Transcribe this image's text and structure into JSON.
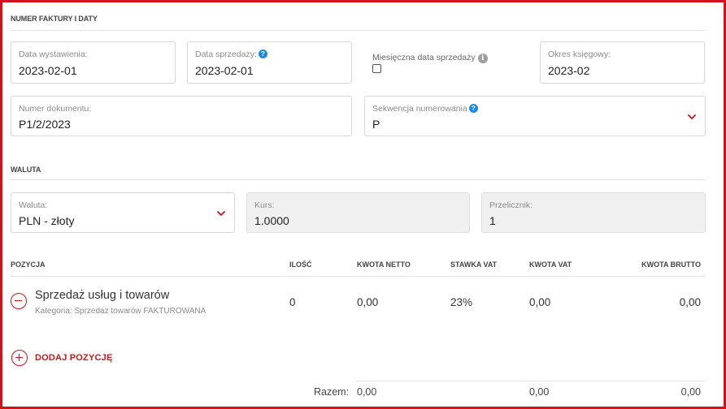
{
  "sections": {
    "invoice": "NUMER FAKTURY I DATY",
    "currency": "WALUTA"
  },
  "fields": {
    "issue_date": {
      "label": "Data wystawienia:",
      "value": "2023-02-01"
    },
    "sale_date": {
      "label": "Data sprzedaży:",
      "value": "2023-02-01"
    },
    "monthly_sale_date": {
      "label": "Miesięczna data sprzedaży",
      "checked": false
    },
    "accounting_period": {
      "label": "Okres księgowy:",
      "value": "2023-02"
    },
    "document_number": {
      "label": "Numer dokumentu:",
      "value": "P1/2/2023"
    },
    "numbering_sequence": {
      "label": "Sekwencja numerowania",
      "value": "P"
    },
    "currency": {
      "label": "Waluta:",
      "value": "PLN - złoty"
    },
    "rate": {
      "label": "Kurs:",
      "value": "1.0000"
    },
    "converter": {
      "label": "Przelicznik:",
      "value": "1"
    }
  },
  "table": {
    "headers": {
      "position": "POZYCJA",
      "quantity": "ILOŚĆ",
      "net": "KWOTA NETTO",
      "vat_rate": "STAWKA VAT",
      "vat": "KWOTA VAT",
      "gross": "KWOTA BRUTTO"
    },
    "rows": [
      {
        "name": "Sprzedaż usług i towarów",
        "category": "Kategoria: Sprzedaz towarów FAKTUROWANA",
        "quantity": "0",
        "net": "0,00",
        "vat_rate": "23%",
        "vat": "0,00",
        "gross": "0,00"
      }
    ],
    "add_label": "DODAJ POZYCJĘ",
    "totals": {
      "label": "Razem:",
      "net": "0,00",
      "vat": "0,00",
      "gross": "0,00"
    }
  },
  "icons": {
    "help": "question-circle-icon",
    "info": "info-circle-icon",
    "dropdown": "chevron-down-icon",
    "remove": "minus-circle-icon",
    "add": "plus-circle-icon"
  },
  "colors": {
    "accent": "#d1121b",
    "help_blue": "#1e88e5",
    "info_gray": "#9e9e9e"
  }
}
